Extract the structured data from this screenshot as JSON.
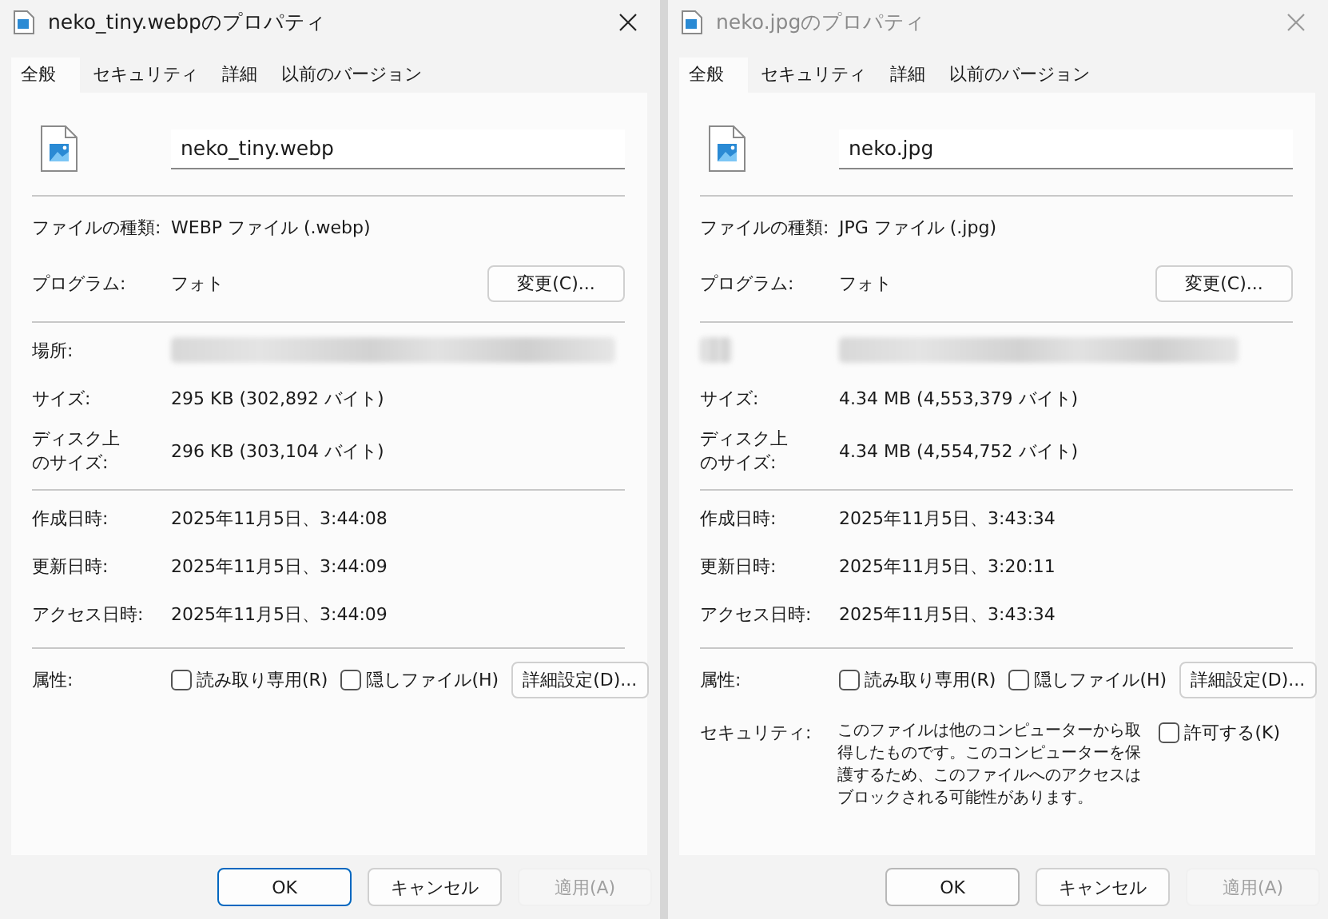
{
  "windows": [
    {
      "title": "neko_tiny.webpのプロパティ",
      "active": true,
      "tabs": [
        {
          "label": "全般",
          "selected": true
        },
        {
          "label": "セキュリティ",
          "selected": false
        },
        {
          "label": "詳細",
          "selected": false
        },
        {
          "label": "以前のバージョン",
          "selected": false
        }
      ],
      "file_name": "neko_tiny.webp",
      "type": {
        "label": "ファイルの種類:",
        "value": "WEBP ファイル (.webp)"
      },
      "program": {
        "label": "プログラム:",
        "value": "フォト",
        "button": "変更(C)..."
      },
      "location": {
        "label": "場所:",
        "label_redacted": false,
        "value_redacted": true
      },
      "size": {
        "label": "サイズ:",
        "value": "295 KB (302,892 バイト)"
      },
      "disk_size": {
        "label": "ディスク上のサイズ:",
        "value": "296 KB (303,104 バイト)"
      },
      "dates": [
        {
          "label": "作成日時:",
          "value": "2025年11月5日、3:44:08"
        },
        {
          "label": "更新日時:",
          "value": "2025年11月5日、3:44:09"
        },
        {
          "label": "アクセス日時:",
          "value": "2025年11月5日、3:44:09"
        }
      ],
      "attributes": {
        "label": "属性:",
        "checkboxes": [
          {
            "label": "読み取り専用(R)",
            "checked": false
          },
          {
            "label": "隠しファイル(H)",
            "checked": false
          }
        ],
        "button": "詳細設定(D)..."
      },
      "buttons": [
        {
          "label": "OK",
          "default": true,
          "disabled": false
        },
        {
          "label": "キャンセル",
          "default": false,
          "disabled": false
        },
        {
          "label": "適用(A)",
          "default": false,
          "disabled": true
        }
      ]
    },
    {
      "title": "neko.jpgのプロパティ",
      "active": false,
      "tabs": [
        {
          "label": "全般",
          "selected": true
        },
        {
          "label": "セキュリティ",
          "selected": false
        },
        {
          "label": "詳細",
          "selected": false
        },
        {
          "label": "以前のバージョン",
          "selected": false
        }
      ],
      "file_name": "neko.jpg",
      "type": {
        "label": "ファイルの種類:",
        "value": "JPG ファイル (.jpg)"
      },
      "program": {
        "label": "プログラム:",
        "value": "フォト",
        "button": "変更(C)..."
      },
      "location": {
        "label_redacted": true,
        "value_redacted": true
      },
      "size": {
        "label": "サイズ:",
        "value": "4.34 MB (4,553,379 バイト)"
      },
      "disk_size": {
        "label": "ディスク上のサイズ:",
        "value": "4.34 MB (4,554,752 バイト)"
      },
      "dates": [
        {
          "label": "作成日時:",
          "value": "2025年11月5日、3:43:34"
        },
        {
          "label": "更新日時:",
          "value": "2025年11月5日、3:20:11"
        },
        {
          "label": "アクセス日時:",
          "value": "2025年11月5日、3:43:34"
        }
      ],
      "attributes": {
        "label": "属性:",
        "checkboxes": [
          {
            "label": "読み取り専用(R)",
            "checked": false
          },
          {
            "label": "隠しファイル(H)",
            "checked": false
          }
        ],
        "button": "詳細設定(D)..."
      },
      "security": {
        "label": "セキュリティ:",
        "text": "このファイルは他のコンピューターから取得したものです。このコンピューターを保護するため、このファイルへのアクセスはブロックされる可能性があります。",
        "checkbox": {
          "label": "許可する(K)",
          "checked": false
        }
      },
      "buttons": [
        {
          "label": "OK",
          "default": true,
          "disabled": false
        },
        {
          "label": "キャンセル",
          "default": false,
          "disabled": false
        },
        {
          "label": "適用(A)",
          "default": false,
          "disabled": true
        }
      ]
    }
  ]
}
